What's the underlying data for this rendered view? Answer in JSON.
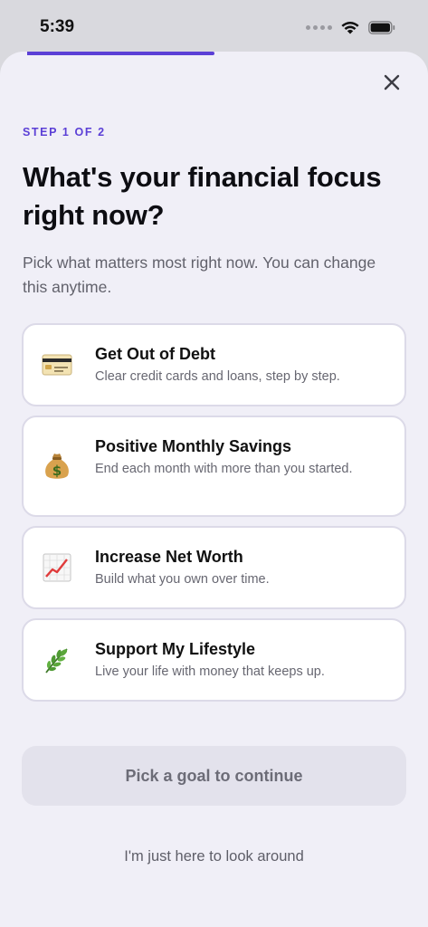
{
  "status_bar": {
    "time": "5:39",
    "icons": [
      "signal-dots-icon",
      "wifi-icon",
      "battery-icon"
    ]
  },
  "progress": {
    "step": 1,
    "total": 2,
    "fraction": 0.5,
    "color": "#5b3fd6"
  },
  "header": {
    "close_icon": "close-icon",
    "step_label": "STEP 1 OF 2",
    "title": "What's your financial focus right now?",
    "subtitle": "Pick what matters most right now. You can change this anytime."
  },
  "options": [
    {
      "icon": "credit-card-icon",
      "title": "Get Out of Debt",
      "description": "Clear credit cards and loans, step by step."
    },
    {
      "icon": "money-bag-icon",
      "title": "Positive Monthly Savings",
      "description": "End each month with more than you started."
    },
    {
      "icon": "chart-increasing-icon",
      "title": "Increase Net Worth",
      "description": "Build what you own over time."
    },
    {
      "icon": "herb-leaf-icon",
      "title": "Support My Lifestyle",
      "description": "Live your life with money that keeps up."
    }
  ],
  "actions": {
    "continue_label": "Pick a goal to continue",
    "look_around_label": "I'm just here to look around"
  },
  "colors": {
    "accent": "#5b3fd6",
    "background": "#f0eff7",
    "card_border": "#dcdae8",
    "disabled_button": "#e3e2ec"
  }
}
